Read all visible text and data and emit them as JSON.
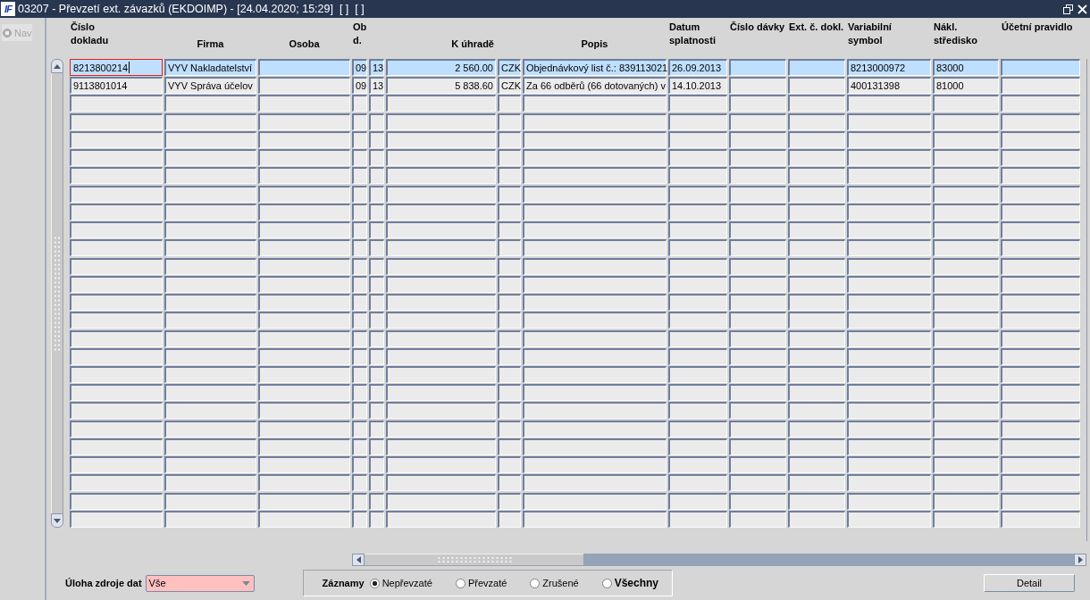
{
  "window": {
    "logo": "IF",
    "title": "03207 - Převzetí ext. závazků (EKDOIMP) - [24.04.2020; 15:29]  [ ]  [ ]"
  },
  "sidebar": {
    "nav": {
      "label": "Nav",
      "disabled": true
    }
  },
  "table": {
    "columns": [
      {
        "header": [
          "Číslo",
          "dokladu"
        ]
      },
      {
        "header": [
          "Firma"
        ]
      },
      {
        "header": [
          "Osoba"
        ]
      },
      {
        "header": [
          "Ob",
          "d."
        ]
      },
      {},
      {
        "header": [
          "K úhradě"
        ]
      },
      {},
      {
        "header": [
          "Popis"
        ]
      },
      {
        "header": [
          "Datum",
          "splatnosti"
        ]
      },
      {
        "header": [
          "Číslo dávky"
        ]
      },
      {
        "header": [
          "Ext. č. dokl."
        ]
      },
      {
        "header": [
          "Variabilní",
          "symbol"
        ]
      },
      {
        "header": [
          "Nákl.",
          "středisko"
        ]
      },
      {
        "header": [
          "Účetní pravidlo"
        ]
      }
    ],
    "rows": [
      {
        "selected": true,
        "cells": [
          {
            "text": "8213800214",
            "focused": true
          },
          {
            "text": "VYV Nakladatelství",
            "focused": false
          },
          {
            "focused": false
          },
          {
            "text": "09",
            "focused": false
          },
          {
            "text": "13",
            "focused": false
          },
          {
            "text": "2 560.00",
            "focused": false
          },
          {
            "text": "CZK",
            "focused": false
          },
          {
            "text": "Objednávkový list č.: 839113021",
            "focused": false
          },
          {
            "text": "26.09.2013",
            "focused": false
          },
          {
            "focused": false
          },
          {
            "focused": false
          },
          {
            "text": "8213000972",
            "focused": false
          },
          {
            "text": "83000",
            "focused": false
          },
          {
            "focused": false
          }
        ]
      },
      {
        "selected": false,
        "cells": [
          {
            "text": "9113801014",
            "focused": false
          },
          {
            "text": "VYV Správa účelov",
            "focused": false
          },
          {
            "focused": false
          },
          {
            "text": "09",
            "focused": false
          },
          {
            "text": "13",
            "focused": false
          },
          {
            "text": "5 838.60",
            "focused": false
          },
          {
            "text": "CZK",
            "focused": false
          },
          {
            "text": "Za 66 odběrů (66 dotovaných) v",
            "focused": false
          },
          {
            "text": "14.10.2013",
            "focused": false
          },
          {
            "focused": false
          },
          {
            "focused": false
          },
          {
            "text": "400131398",
            "focused": false
          },
          {
            "text": "81000",
            "focused": false
          },
          {
            "focused": false
          }
        ]
      },
      {
        "selected": false
      },
      {
        "selected": false
      },
      {
        "selected": false
      },
      {
        "selected": false
      },
      {
        "selected": false
      },
      {
        "selected": false
      },
      {
        "selected": false
      },
      {
        "selected": false
      },
      {
        "selected": false
      },
      {
        "selected": false
      },
      {
        "selected": false
      },
      {
        "selected": false
      },
      {
        "selected": false
      },
      {
        "selected": false
      },
      {
        "selected": false
      },
      {
        "selected": false
      },
      {
        "selected": false
      },
      {
        "selected": false
      },
      {
        "selected": false
      },
      {
        "selected": false
      },
      {
        "selected": false
      },
      {
        "selected": false
      },
      {
        "selected": false
      },
      {
        "selected": false
      }
    ]
  },
  "source": {
    "label": "Úloha zdroje dat",
    "value": "Vše",
    "required": true
  },
  "records": {
    "label": "Záznamy",
    "options": [
      {
        "label": "Nepřevzaté",
        "selected": true,
        "emphasized": false
      },
      {
        "label": "Převzaté",
        "selected": false,
        "emphasized": false
      },
      {
        "label": "Zrušené",
        "selected": false,
        "emphasized": false
      },
      {
        "label": "Všechny",
        "selected": false,
        "emphasized": true
      }
    ]
  },
  "buttons": [
    {
      "label": "Detail"
    }
  ]
}
